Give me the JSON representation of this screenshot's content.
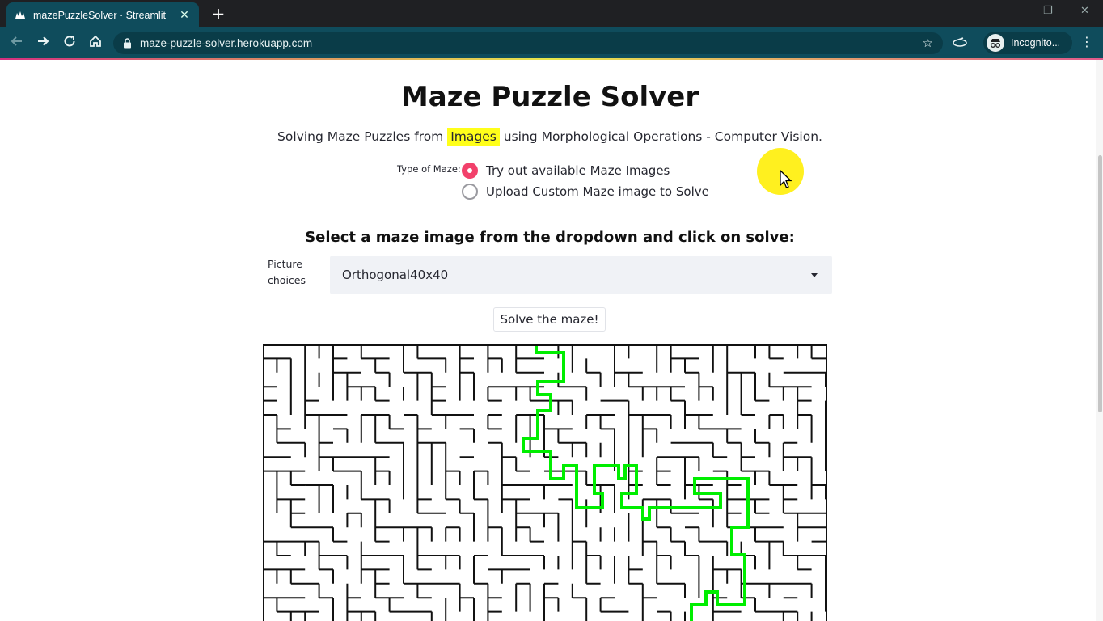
{
  "browser": {
    "tab_title": "mazePuzzleSolver · Streamlit",
    "url": "maze-puzzle-solver.herokuapp.com",
    "profile_label": "Incognito...",
    "new_tab_symbol": "+",
    "close_symbol": "✕",
    "menu_symbol": "⋮",
    "window_minimize": "—",
    "window_restore": "❐",
    "window_close": "✕"
  },
  "page": {
    "title": "Maze Puzzle Solver",
    "subtitle_before": "Solving Maze Puzzles from ",
    "subtitle_highlight": "Images",
    "subtitle_after": " using Morphological Operations - Computer Vision.",
    "maze_type": {
      "label": "Type of Maze:",
      "options": [
        {
          "label": "Try out available Maze Images",
          "selected": true
        },
        {
          "label": "Upload Custom Maze image to Solve",
          "selected": false
        }
      ]
    },
    "section_heading": "Select a maze image from the dropdown and click on solve:",
    "picture_choices_label": "Picture choices",
    "picture_selected": "Orthogonal40x40",
    "solve_button": "Solve the maze!"
  },
  "colors": {
    "chrome_dark": "#1f2023",
    "chrome_teal": "#0f4c5c",
    "radio_accent": "#f2416b",
    "highlight": "#ffff1a",
    "path_green": "#00ee00"
  }
}
